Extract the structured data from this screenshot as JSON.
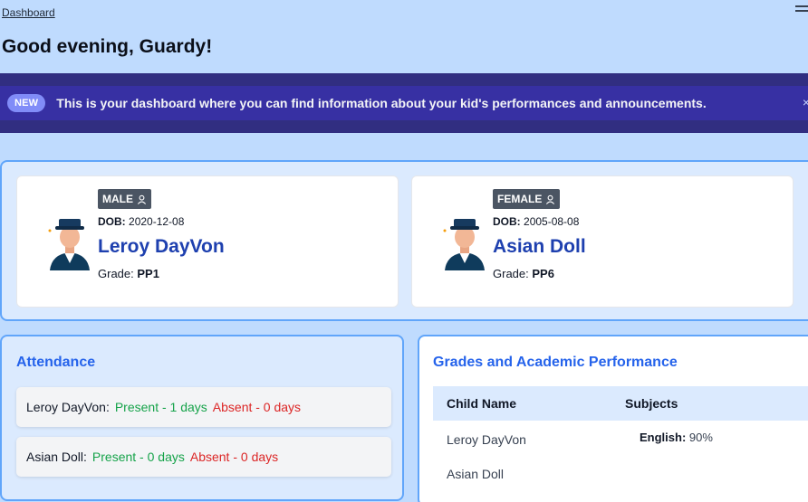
{
  "breadcrumb": {
    "label": "Dashboard"
  },
  "greeting": "Good evening, Guardy!",
  "banner": {
    "badge": "NEW",
    "message": "This is your dashboard where you can find information about your kid's performances and announcements.",
    "close": "×"
  },
  "children": [
    {
      "gender": "MALE",
      "dob_label": "DOB:",
      "dob": "2020-12-08",
      "name": "Leroy DayVon",
      "grade_label": "Grade:",
      "grade": "PP1"
    },
    {
      "gender": "FEMALE",
      "dob_label": "DOB:",
      "dob": "2005-08-08",
      "name": "Asian Doll",
      "grade_label": "Grade:",
      "grade": "PP6"
    }
  ],
  "attendance": {
    "title": "Attendance",
    "rows": [
      {
        "name": "Leroy DayVon:",
        "present": "Present - 1 days",
        "absent": "Absent - 0 days"
      },
      {
        "name": "Asian Doll:",
        "present": "Present - 0 days",
        "absent": "Absent - 0 days"
      }
    ]
  },
  "grades": {
    "title": "Grades and Academic Performance",
    "columns": [
      "Child Name",
      "Subjects"
    ],
    "rows": [
      {
        "name": "Leroy DayVon",
        "subject": "English:",
        "score": "90%"
      },
      {
        "name": "Asian Doll"
      }
    ]
  },
  "colors": {
    "accent": "#2563eb",
    "present": "#16a34a",
    "absent": "#dc2626",
    "banner": "#312e81",
    "badge": "#818cf8"
  }
}
